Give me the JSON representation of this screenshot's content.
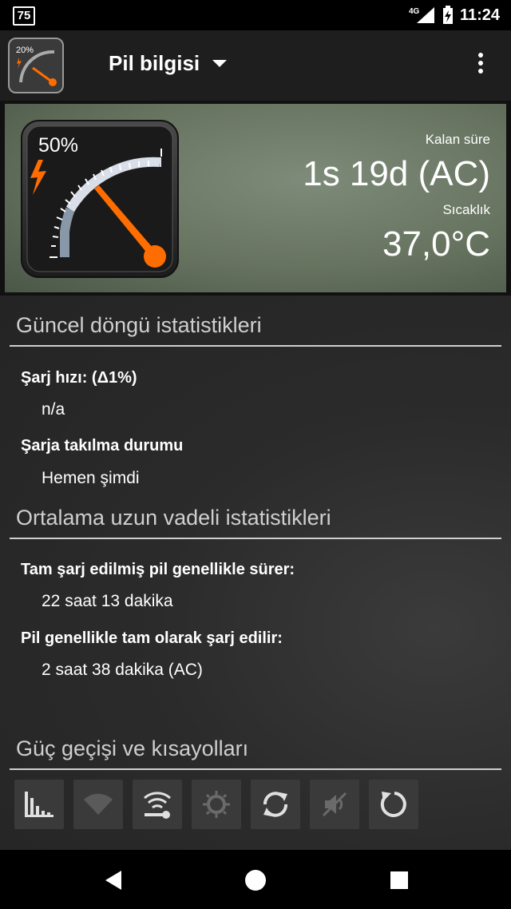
{
  "statusbar": {
    "notification_badge": "75",
    "network": "4G",
    "time": "11:24"
  },
  "toolbar": {
    "title": "Pil bilgisi",
    "app_icon_percent": "20%"
  },
  "hero": {
    "gauge_percent": "50%",
    "remaining_label": "Kalan süre",
    "remaining_value": "1s 19d (AC)",
    "temperature_label": "Sıcaklık",
    "temperature_value": "37,0°C"
  },
  "sections": {
    "current": {
      "title": "Güncel döngü istatistikleri",
      "charge_rate_label": "Şarj hızı: (Δ1%)",
      "charge_rate_value": "n/a",
      "plugged_label": "Şarja takılma durumu",
      "plugged_value": "Hemen şimdi"
    },
    "average": {
      "title": "Ortalama uzun vadeli istatistikleri",
      "full_lasts_label": "Tam şarj edilmiş pil genellikle sürer:",
      "full_lasts_value": "22 saat 13 dakika",
      "full_charge_label": "Pil genellikle tam olarak şarj edilir:",
      "full_charge_value": "2 saat 38 dakika (AC)"
    },
    "shortcuts": {
      "title": "Güç geçişi ve kısayolları",
      "items": [
        "chart-icon",
        "wifi-icon",
        "wifi-settings-icon",
        "brightness-icon",
        "sync-icon",
        "mute-icon",
        "refresh-icon"
      ]
    }
  },
  "colors": {
    "accent": "#ff6d00",
    "gauge_arc": "#d9dee9",
    "gauge_arc_low": "#8898a8",
    "toolbar": "#1e1e1e"
  }
}
